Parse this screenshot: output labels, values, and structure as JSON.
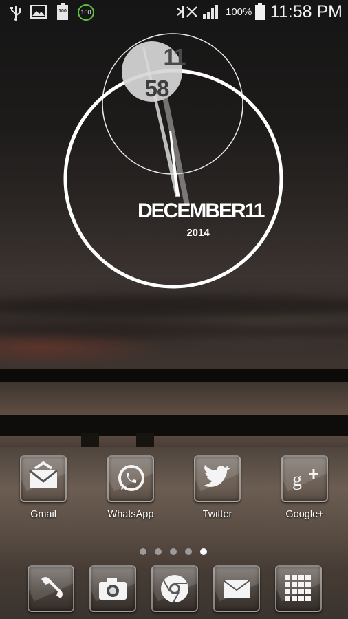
{
  "status_bar": {
    "battery_level_icon_text": "100",
    "badge_text": "100",
    "battery_percent": "100%",
    "time": "11:58 PM",
    "icons": [
      "usb-icon",
      "gallery-icon",
      "battery-notice-icon",
      "battery-circle-icon",
      "mute-icon",
      "signal-icon",
      "battery-icon"
    ]
  },
  "clock_widget": {
    "hour": "11",
    "minute": "58",
    "date": "DECEMBER11",
    "year": "2014"
  },
  "home_apps": [
    {
      "label": "Gmail",
      "icon": "gmail-icon"
    },
    {
      "label": "WhatsApp",
      "icon": "whatsapp-icon"
    },
    {
      "label": "Twitter",
      "icon": "twitter-icon"
    },
    {
      "label": "Google+",
      "icon": "google-plus-icon"
    }
  ],
  "page_indicator": {
    "count": 5,
    "active_index": 4
  },
  "dock": [
    {
      "icon": "phone-icon"
    },
    {
      "icon": "camera-icon"
    },
    {
      "icon": "chrome-icon"
    },
    {
      "icon": "email-icon"
    },
    {
      "icon": "apps-grid-icon"
    }
  ],
  "colors": {
    "text": "#ffffff",
    "clock_ring": "#ffffff",
    "hand_highlight": "#d9d9d9"
  }
}
